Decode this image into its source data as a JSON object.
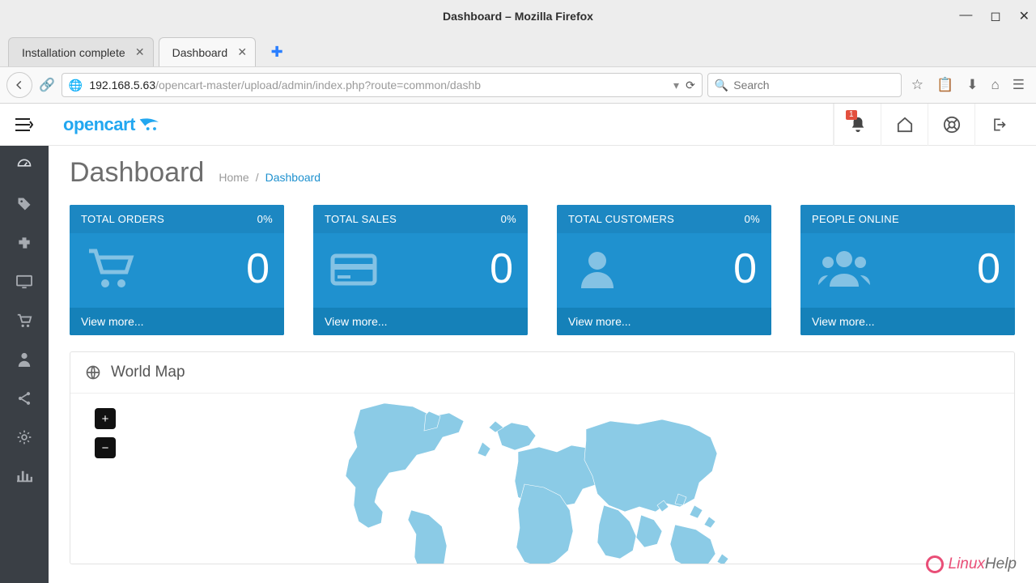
{
  "window": {
    "title": "Dashboard – Mozilla Firefox"
  },
  "tabs": [
    {
      "label": "Installation complete",
      "active": false
    },
    {
      "label": "Dashboard",
      "active": true
    }
  ],
  "url": {
    "host": "192.168.5.63",
    "path": "/opencart-master/upload/admin/index.php?route=common/dashb"
  },
  "search": {
    "placeholder": "Search"
  },
  "brand": "opencart",
  "notif": {
    "count": "1"
  },
  "page": {
    "title": "Dashboard"
  },
  "breadcrumb": {
    "home": "Home",
    "sep": "/",
    "current": "Dashboard"
  },
  "tiles": [
    {
      "label": "TOTAL ORDERS",
      "pct": "0%",
      "value": "0",
      "more": "View more..."
    },
    {
      "label": "TOTAL SALES",
      "pct": "0%",
      "value": "0",
      "more": "View more..."
    },
    {
      "label": "TOTAL CUSTOMERS",
      "pct": "0%",
      "value": "0",
      "more": "View more..."
    },
    {
      "label": "PEOPLE ONLINE",
      "pct": "",
      "value": "0",
      "more": "View more..."
    }
  ],
  "map": {
    "title": "World Map",
    "zoom_in": "+",
    "zoom_out": "−"
  },
  "watermark": {
    "l": "Linux",
    "h": "Help"
  }
}
